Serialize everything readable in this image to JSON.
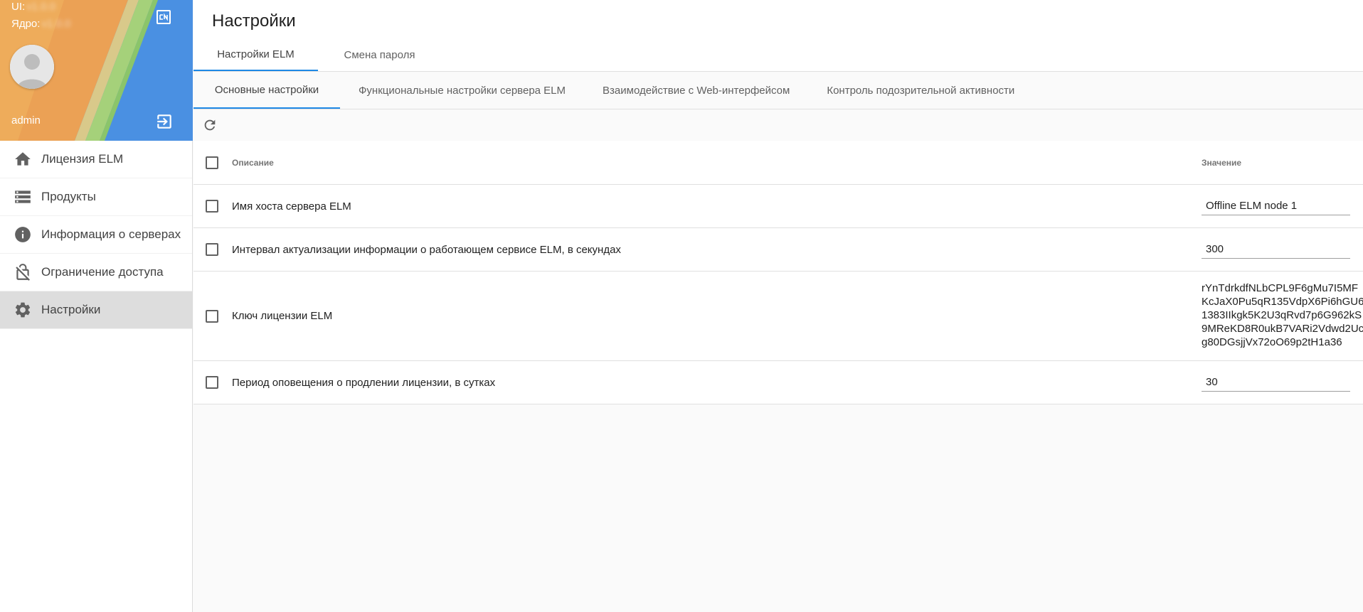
{
  "sidebar": {
    "ui_label": "UI:",
    "core_label": "Ядро:",
    "ui_version": "v1.0.0",
    "core_version": "v1.0.0",
    "username": "admin",
    "colors": {
      "blue": "#4a90e2",
      "orange": "#eba155",
      "green": "#a5d17a",
      "active_bg": "#dddddd"
    },
    "nav": [
      {
        "label": "Лицензия ELM",
        "icon": "home-icon"
      },
      {
        "label": "Продукты",
        "icon": "list-icon"
      },
      {
        "label": "Информация о серверах",
        "icon": "info-icon"
      },
      {
        "label": "Ограничение доступа",
        "icon": "lock-off-icon"
      },
      {
        "label": "Настройки",
        "icon": "gear-icon",
        "active": true
      }
    ]
  },
  "header": {
    "title": "Настройки",
    "tabs": [
      {
        "label": "Настройки ELM",
        "active": true
      },
      {
        "label": "Смена пароля"
      }
    ]
  },
  "subtabs": [
    {
      "label": "Основные настройки",
      "active": true
    },
    {
      "label": "Функциональные настройки сервера ELM"
    },
    {
      "label": "Взаимодействие с Web-интерфейсом"
    },
    {
      "label": "Контроль подозрительной активности"
    }
  ],
  "table": {
    "columns": {
      "description": "Описание",
      "value": "Значение"
    },
    "rows": [
      {
        "description": "Имя хоста сервера ELM",
        "value": "Offline ELM node 1"
      },
      {
        "description": "Интервал актуализации информации о работающем сервисе ELM, в секундах",
        "value": "300"
      },
      {
        "description": "Ключ лицензии ELM",
        "value": "rYnTdrkdfNLbCPL9F6gMu7I5MF\nKcJaX0Pu5qR135VdpX6Pi6hGU6\n1383IIkgk5K2U3qRvd7p6G962kS\n9MReKD8R0ukB7VARi2Vdwd2Uc\ng80DGsjjVx72oO69p2tH1a36"
      },
      {
        "description": "Период оповещения о продлении лицензии, в сутках",
        "value": "30"
      }
    ]
  },
  "accent_color": "#1e88e5"
}
